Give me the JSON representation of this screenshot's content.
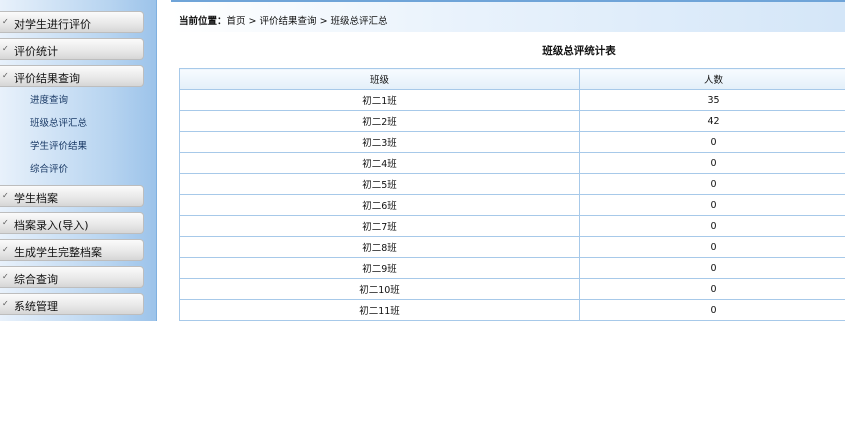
{
  "sidebar": {
    "menus_top": [
      {
        "label": "对学生进行评价"
      },
      {
        "label": "评价统计"
      },
      {
        "label": "评价结果查询"
      }
    ],
    "sub_items": [
      {
        "label": "进度查询"
      },
      {
        "label": "班级总评汇总"
      },
      {
        "label": "学生评价结果"
      },
      {
        "label": "综合评价"
      }
    ],
    "menus_bottom": [
      {
        "label": "学生档案"
      },
      {
        "label": "档案录入(导入)"
      },
      {
        "label": "生成学生完整档案"
      },
      {
        "label": "综合查询"
      },
      {
        "label": "系统管理"
      }
    ]
  },
  "breadcrumb": {
    "prefix": "当前位置：",
    "home": "首页",
    "sep": " > ",
    "level1": "评价结果查询",
    "level2": "班级总评汇总"
  },
  "page_title": "班级总评统计表",
  "table": {
    "headers": [
      "班级",
      "人数"
    ],
    "rows": [
      [
        "初二1班",
        "35"
      ],
      [
        "初二2班",
        "42"
      ],
      [
        "初二3班",
        "0"
      ],
      [
        "初二4班",
        "0"
      ],
      [
        "初二5班",
        "0"
      ],
      [
        "初二6班",
        "0"
      ],
      [
        "初二7班",
        "0"
      ],
      [
        "初二8班",
        "0"
      ],
      [
        "初二9班",
        "0"
      ],
      [
        "初二10班",
        "0"
      ],
      [
        "初二11班",
        "0"
      ]
    ]
  }
}
